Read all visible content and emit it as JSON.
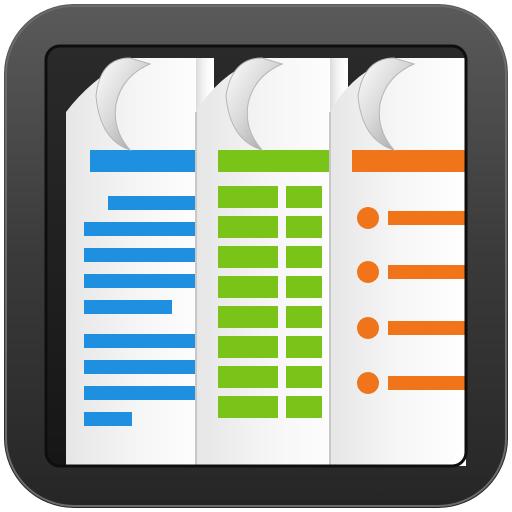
{
  "icon": {
    "name": "documents-to-go-app-icon",
    "colors": {
      "frame_dark": "#222222",
      "frame_light": "#555555",
      "inner_panel": "#1c1c1c",
      "paper": "#f2f2f2",
      "paper_shadow": "#cfcfcf",
      "word_blue": "#1f8fe0",
      "sheet_green": "#7ac41a",
      "slides_orange": "#f0741a"
    },
    "documents": [
      {
        "name": "word-document",
        "accent": "#1f8fe0"
      },
      {
        "name": "spreadsheet-document",
        "accent": "#7ac41a"
      },
      {
        "name": "presentation-document",
        "accent": "#f0741a"
      }
    ]
  }
}
